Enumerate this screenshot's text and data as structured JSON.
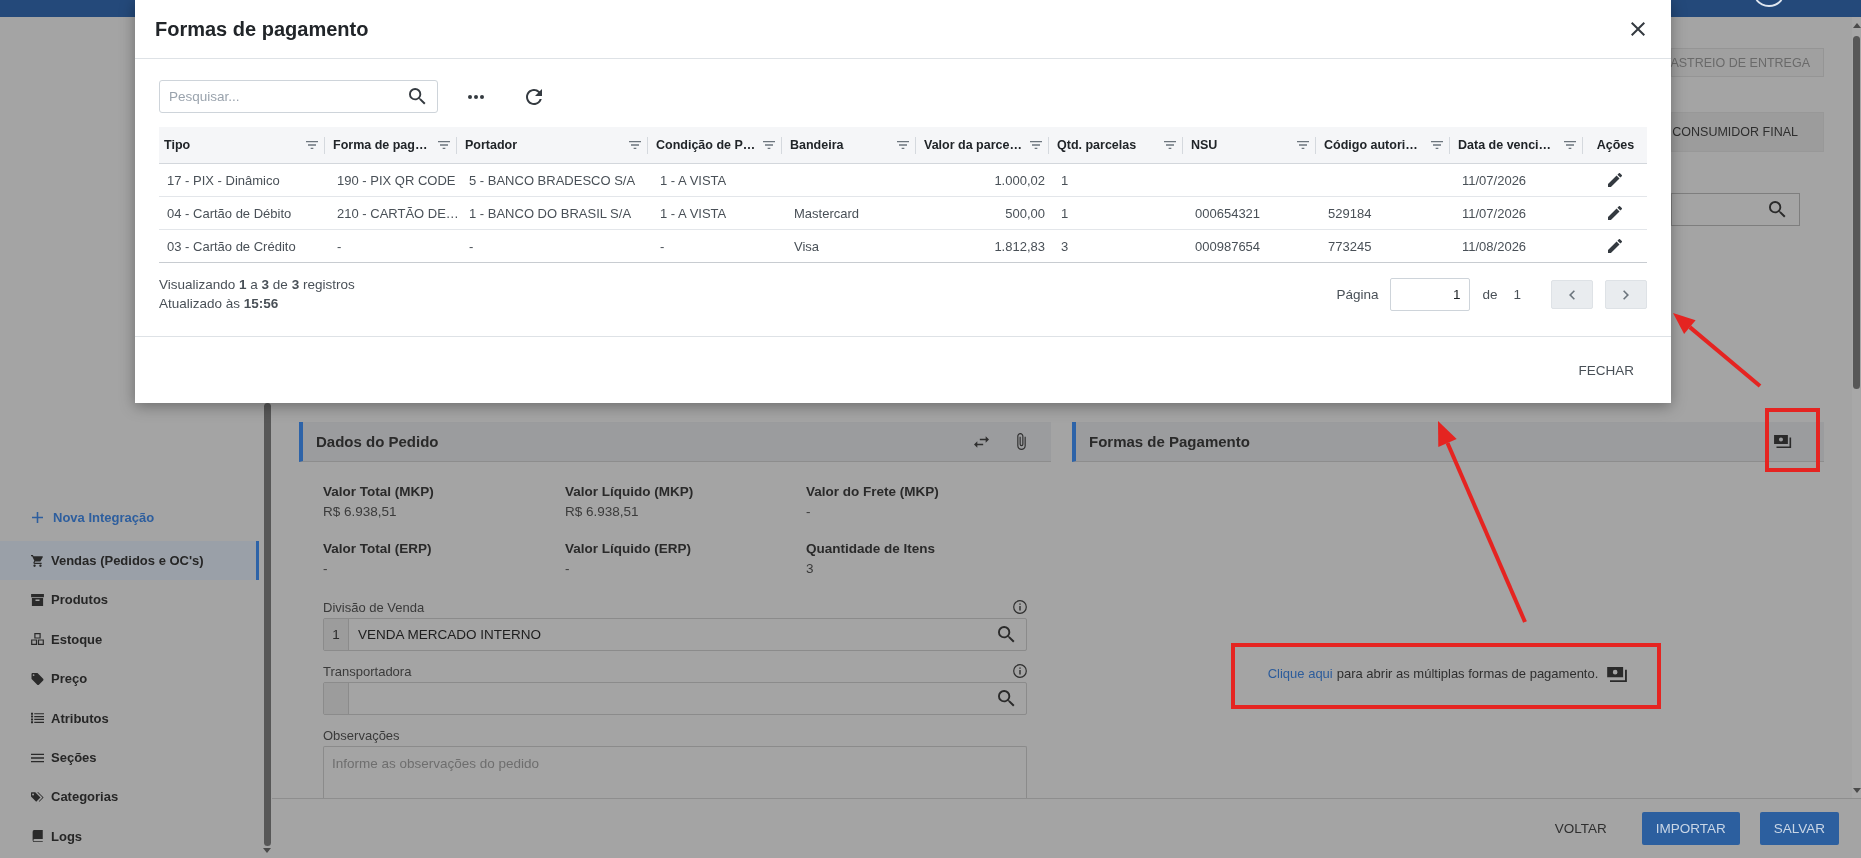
{
  "sidebar": {
    "action": "Nova Integração",
    "items": [
      {
        "label": "Vendas (Pedidos e OC's)",
        "selected": true
      },
      {
        "label": "Produtos",
        "selected": false
      },
      {
        "label": "Estoque",
        "selected": false
      },
      {
        "label": "Preço",
        "selected": false
      },
      {
        "label": "Atributos",
        "selected": false
      },
      {
        "label": "Seções",
        "selected": false
      },
      {
        "label": "Categorias",
        "selected": false
      },
      {
        "label": "Logs",
        "selected": false
      }
    ]
  },
  "top_actions": [
    {
      "label": "ASTREIO DE ENTREGA",
      "disabled": true
    },
    {
      "label": "CONSUMIDOR FINAL",
      "disabled": false
    }
  ],
  "order_panel": {
    "title": "Dados do Pedido",
    "summary": [
      {
        "label": "Valor Total (MKP)",
        "value": "R$ 6.938,51"
      },
      {
        "label": "Valor Líquido (MKP)",
        "value": "R$ 6.938,51"
      },
      {
        "label": "Valor do Frete (MKP)",
        "value": "-"
      },
      {
        "label": "Valor Total (ERP)",
        "value": "-"
      },
      {
        "label": "Valor Líquido (ERP)",
        "value": "-"
      },
      {
        "label": "Quantidade de Itens",
        "value": "3"
      }
    ],
    "lookups": [
      {
        "label": "Divisão de Venda",
        "code": "1",
        "value": "VENDA MERCADO INTERNO"
      },
      {
        "label": "Transportadora"
      }
    ],
    "notes": {
      "label": "Observações",
      "placeholder": "Informe as observações do pedido"
    }
  },
  "payment_panel": {
    "title": "Formas de Pagamento",
    "hint": {
      "link": "Clique aqui",
      "text": "para abrir as múltiplas formas de pagamento."
    }
  },
  "footer_buttons": [
    {
      "label": "VOLTAR",
      "kind": "flat"
    },
    {
      "label": "IMPORTAR",
      "kind": "raised"
    },
    {
      "label": "SALVAR",
      "kind": "raised"
    }
  ],
  "modal": {
    "title": "Formas de pagamento",
    "search": {
      "placeholder": "Pesquisar..."
    },
    "table": {
      "columns": [
        {
          "label": "Tipo",
          "kind": "text"
        },
        {
          "label": "Forma de pag…",
          "kind": "text"
        },
        {
          "label": "Portador",
          "kind": "text"
        },
        {
          "label": "Condição de P…",
          "kind": "text"
        },
        {
          "label": "Bandeira",
          "kind": "text"
        },
        {
          "label": "Valor da parce…",
          "kind": "number"
        },
        {
          "label": "Qtd. parcelas",
          "kind": "text"
        },
        {
          "label": "NSU",
          "kind": "text"
        },
        {
          "label": "Código autori…",
          "kind": "text"
        },
        {
          "label": "Data de venci…",
          "kind": "text"
        },
        {
          "label": "Ações",
          "kind": "actions"
        }
      ],
      "rows": [
        [
          "17 - PIX - Dinâmico",
          "190 - PIX QR CODE",
          "5 - BANCO BRADESCO S/A",
          "1 - A VISTA",
          null,
          "1.000,02",
          "1",
          null,
          null,
          "11/07/2026"
        ],
        [
          "04 - Cartão de Débito",
          "210 - CARTÃO DE…",
          "1 - BANCO DO BRASIL S/A",
          "1 - A VISTA",
          "Mastercard",
          "500,00",
          "1",
          "000654321",
          "529184",
          "11/07/2026"
        ],
        [
          "03 - Cartão de Crédito",
          "-",
          "-",
          "-",
          "Visa",
          "1.812,83",
          "3",
          "000987654",
          "773245",
          "11/08/2026"
        ]
      ]
    },
    "records": "Visualizando **1** a **3** de **3** registros",
    "updated": "Atualizado às **15:56**",
    "pagination": {
      "label": "Página",
      "page": "1",
      "of": "de",
      "total": "1"
    },
    "close_label": "FECHAR"
  }
}
